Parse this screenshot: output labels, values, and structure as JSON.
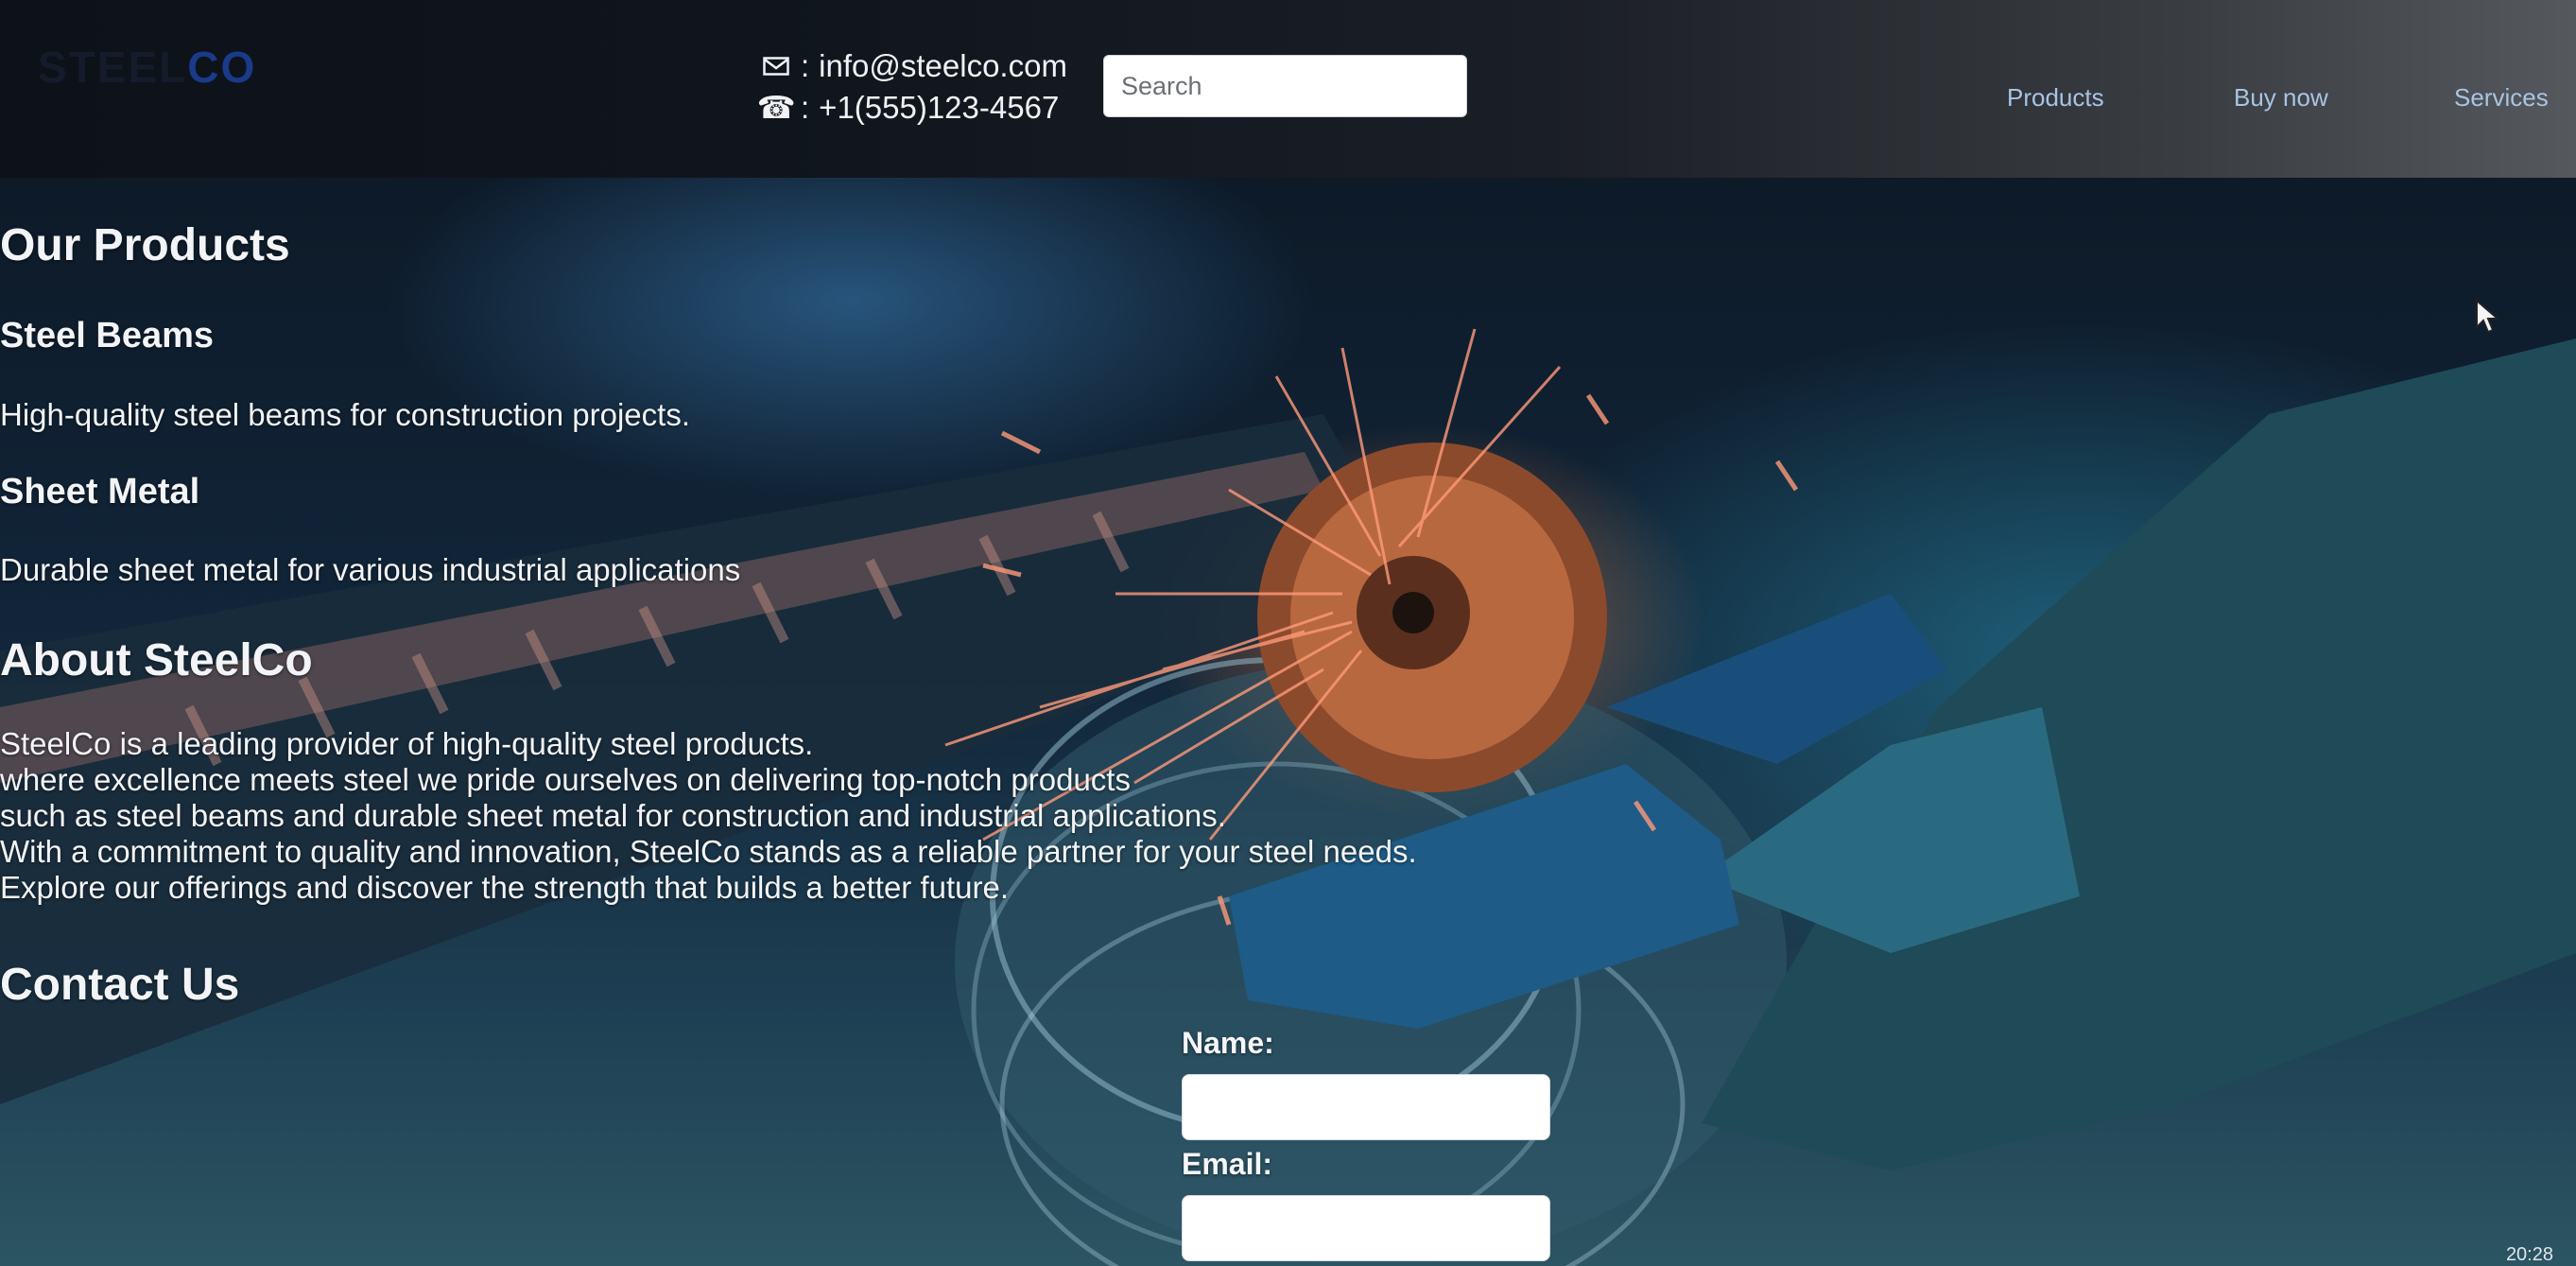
{
  "header": {
    "logo": {
      "left": "STEEL",
      "right": "CO"
    },
    "email": "info@steelco.com",
    "phone": "+1(555)123-4567",
    "email_prefix": ":",
    "phone_prefix": ":",
    "search": {
      "placeholder": "Search",
      "value": ""
    },
    "nav": [
      "Products",
      "Buy now",
      "Services"
    ]
  },
  "products": {
    "heading": "Our Products",
    "items": [
      {
        "title": "Steel Beams",
        "description": "High-quality steel beams for construction projects."
      },
      {
        "title": "Sheet Metal",
        "description": "Durable sheet metal for various industrial applications"
      }
    ]
  },
  "about": {
    "heading": "About SteelCo",
    "lines": [
      "SteelCo is a leading provider of high-quality steel products.",
      "where excellence meets steel we pride ourselves on delivering top-notch products",
      "such as steel beams and durable sheet metal for construction and industrial applications.",
      "With a commitment to quality and innovation, SteelCo stands as a reliable partner for your steel needs.",
      "Explore our offerings and discover the strength that builds a better future."
    ]
  },
  "contact": {
    "heading": "Contact Us",
    "name_label": "Name:",
    "email_label": "Email:",
    "name_value": "",
    "email_value": ""
  },
  "taskbar": {
    "time": "20:28"
  },
  "icons": {
    "email": "envelope-icon",
    "phone": "phone-icon"
  },
  "colors": {
    "nav_link": "#a8c4e6",
    "logo_accent": "#1a3a8a",
    "text": "#f2f4f8"
  }
}
